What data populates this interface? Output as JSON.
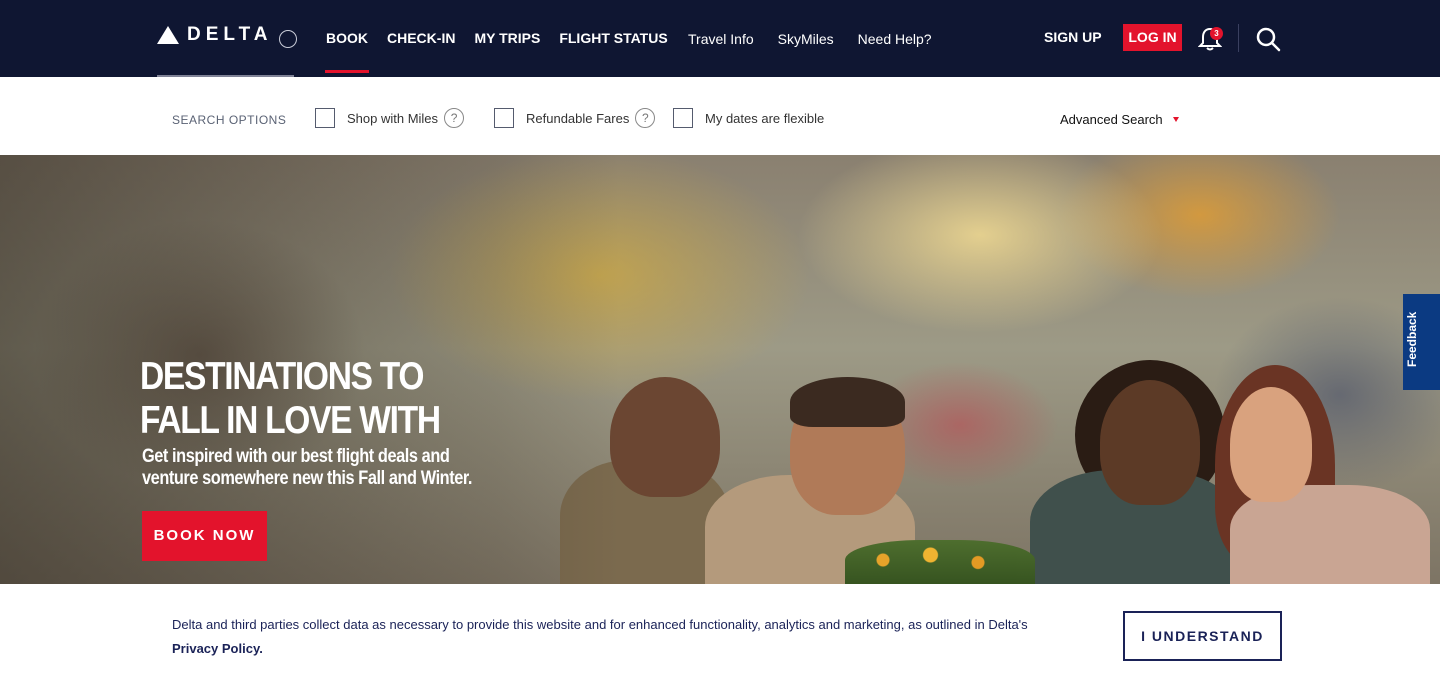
{
  "header": {
    "brand": "DELTA",
    "main_nav": [
      {
        "label": "BOOK"
      },
      {
        "label": "CHECK-IN"
      },
      {
        "label": "MY TRIPS"
      },
      {
        "label": "FLIGHT STATUS"
      }
    ],
    "sub_nav": [
      {
        "label": "Travel Info"
      },
      {
        "label": "SkyMiles"
      },
      {
        "label": "Need Help?"
      }
    ],
    "sign_up": "SIGN UP",
    "log_in": "LOG IN",
    "notification_count": "3",
    "icons": {
      "bell": "bell-icon",
      "search": "search-icon"
    }
  },
  "search_options": {
    "label": "SEARCH OPTIONS",
    "options": [
      {
        "label": "Shop with Miles",
        "help": "?"
      },
      {
        "label": "Refundable Fares",
        "help": "?"
      },
      {
        "label": "My dates are flexible"
      }
    ],
    "advanced": "Advanced Search"
  },
  "hero": {
    "title_line1": "DESTINATIONS TO",
    "title_line2": "FALL IN LOVE WITH",
    "subtitle_line1": "Get inspired with our best flight deals and",
    "subtitle_line2": "venture somewhere new this Fall and Winter.",
    "cta": "BOOK NOW"
  },
  "feedback": "Feedback",
  "cookie": {
    "text": "Delta and third parties collect data as necessary to provide this website and for enhanced functionality, analytics and marketing, as outlined in Delta's ",
    "link": "Privacy Policy.",
    "button": "I UNDERSTAND"
  },
  "colors": {
    "navy": "#0f1632",
    "red": "#e3132c",
    "text_navy": "#1a2257",
    "feedback_blue": "#0b3a82"
  }
}
